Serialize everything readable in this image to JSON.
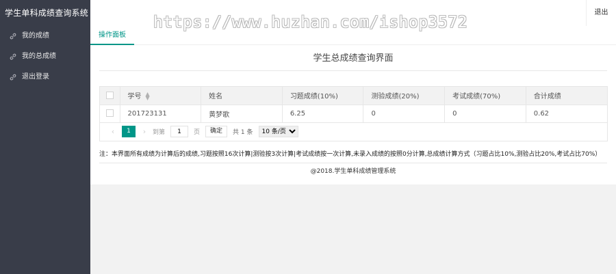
{
  "app": {
    "title": "学生单科成绩查询系统",
    "logout": "退出"
  },
  "sidebar": {
    "items": [
      {
        "label": "我的成绩",
        "icon": "link-icon"
      },
      {
        "label": "我的总成绩",
        "icon": "link-icon"
      },
      {
        "label": "退出登录",
        "icon": "link-icon"
      }
    ]
  },
  "watermark": "https://www.huzhan.com/ishop3572",
  "tabs": [
    {
      "label": "操作面板",
      "active": true
    }
  ],
  "main": {
    "title": "学生总成绩查询界面"
  },
  "table": {
    "headers": [
      "学号",
      "姓名",
      "习题成绩(10%)",
      "测验成绩(20%)",
      "考试成绩(70%)",
      "合计成绩"
    ],
    "rows": [
      [
        "201723131",
        "黄梦歌",
        "6.25",
        "0",
        "0",
        "0.62"
      ]
    ]
  },
  "pager": {
    "current_page": "1",
    "goto_label": "到第",
    "page_unit": "页",
    "goto_value": "1",
    "confirm": "确定",
    "total": "共 1 条",
    "page_size": "10 条/页"
  },
  "note": "注：本界面所有成绩为计算后的成绩,习题按照16次计算|测验按3次计算|考试成绩按一次计算,未录入成绩的按照0分计算,总成绩计算方式（习题占比10%,测验占比20%,考试占比70%）",
  "footer": "@2018.学生单科成绩管理系统",
  "colors": {
    "sidebar_bg": "#393d49",
    "accent": "#009688"
  }
}
